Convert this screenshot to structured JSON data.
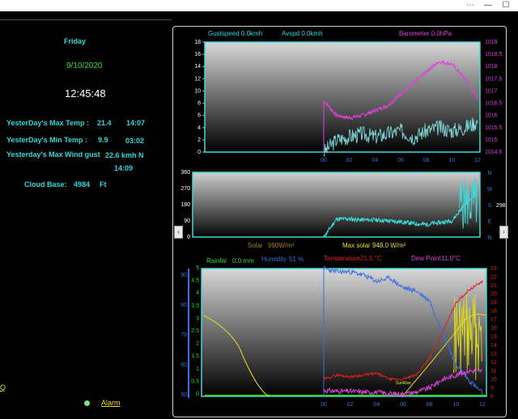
{
  "window": {
    "minimize": "—",
    "maximize": "☐",
    "close": "✕",
    "extra": "⋯"
  },
  "left": {
    "day": "Friday",
    "date": "9/10/2020",
    "time": "12:45:48",
    "max_temp_label": "YesterDay's Max Temp :",
    "max_temp_value": "21.4",
    "max_temp_time": "14:07",
    "min_temp_label": "YesterDay's Min Temp :",
    "min_temp_value": "9.9",
    "min_temp_time": "03:02",
    "max_gust_label": "Yesterday's Max Wind gust",
    "max_gust_value": "22.6 kmh N",
    "max_gust_time": "14:09",
    "cloud_label": "Cloud Base:",
    "cloud_value": "4984",
    "cloud_unit": "Ft",
    "alarm_label": "Alarm",
    "left_link": "Q"
  },
  "chart_data": [
    {
      "type": "line",
      "legend": {
        "gust": "Gustspeed  0.0kmh",
        "avg": "Avspd  0.0kmh",
        "baro": "Barometer     0.0hPa"
      },
      "x_ticks": [
        "00",
        "02",
        "04",
        "06",
        "08",
        "10",
        "12"
      ],
      "y_left_ticks": [
        "18",
        "16",
        "14",
        "12",
        "10",
        "8",
        "6",
        "4",
        "2",
        "0"
      ],
      "y_right_ticks": [
        "1019",
        "1018.5",
        "1018",
        "1017.5",
        "1017",
        "1016.5",
        "1016",
        "1015.5",
        "1015",
        "1014.5"
      ],
      "ylim": [
        0,
        18
      ],
      "ylim_right": [
        1014.5,
        1019
      ],
      "colors": {
        "baro": "#e040e0",
        "wind": "#7fd8d8"
      },
      "series": [
        {
          "name": "Barometer",
          "x": [
            0,
            1,
            2,
            3,
            4,
            5,
            6,
            7,
            8,
            9,
            10,
            11,
            12
          ],
          "values": [
            1016.6,
            1016,
            1015.9,
            1016,
            1016.2,
            1016.4,
            1016.9,
            1017.3,
            1017.8,
            1018.2,
            1018.1,
            1017.5,
            1016.7
          ]
        },
        {
          "name": "Gustspeed",
          "x": [
            0,
            1,
            2,
            3,
            4,
            5,
            6,
            7,
            8,
            9,
            10,
            11,
            12
          ],
          "values": [
            0,
            2,
            2.5,
            3,
            2.5,
            3,
            3.5,
            2.5,
            3.5,
            4,
            3.5,
            4,
            5
          ]
        }
      ]
    },
    {
      "type": "line",
      "y_left_ticks": [
        "360",
        "270",
        "180",
        "90",
        "0"
      ],
      "y_right_ticks": [
        "N",
        "W",
        "S",
        "E",
        "N"
      ],
      "right_value": "298",
      "ylim": [
        0,
        360
      ],
      "colors": {
        "dir": "#40d8d8"
      },
      "series": [
        {
          "name": "Wind Direction",
          "x": [
            0,
            1,
            2,
            3,
            4,
            5,
            6,
            7,
            8,
            9,
            10,
            11,
            12
          ],
          "values": [
            0,
            100,
            100,
            95,
            95,
            90,
            85,
            75,
            70,
            80,
            90,
            180,
            250
          ]
        }
      ]
    },
    {
      "type": "line",
      "solar": {
        "label": "Solar",
        "value": "990W/m²",
        "max_label": "Max solar",
        "max_value": "948.0 W/m²"
      },
      "legend": {
        "rain": "Rainfal",
        "rain_value": "0.0 mm",
        "hum": "Humidity",
        "hum_value": "51 %",
        "temp": "Temperature",
        "temp_value": "21.5 °C",
        "dew": "Dew Point",
        "dew_value": "11.0°C"
      },
      "annotation": "SunRise",
      "x_ticks": [
        "00",
        "02",
        "04",
        "06",
        "08",
        "10",
        "12"
      ],
      "y_rain_ticks": [
        "5",
        "4.5",
        "4",
        "3.5",
        "3",
        "2.5",
        "2",
        "1.5",
        "1",
        "0.5",
        "0"
      ],
      "y_hum_ticks": [
        "90",
        "80",
        "70",
        "60",
        "50"
      ],
      "y_temp_ticks": [
        "23",
        "22",
        "21",
        "20",
        "19",
        "18",
        "17",
        "16",
        "15",
        "14",
        "13",
        "12",
        "11",
        "10",
        "9",
        "8"
      ],
      "ylim_temp": [
        8,
        23
      ],
      "ylim_hum": [
        50,
        90
      ],
      "colors": {
        "temp": "#e02020",
        "hum": "#3a6fe0",
        "dew": "#e040e0",
        "solar": "#e8e020",
        "rain": "#30d830"
      },
      "series": [
        {
          "name": "Temperature",
          "x": [
            0,
            1,
            2,
            3,
            4,
            5,
            6,
            7,
            8,
            9,
            10,
            11,
            12
          ],
          "values": [
            10,
            10.5,
            10.3,
            10.5,
            10.7,
            10,
            10,
            10.5,
            12.5,
            15.5,
            19,
            20.5,
            21.5
          ]
        },
        {
          "name": "Humidity",
          "x": [
            0,
            1,
            2,
            3,
            4,
            5,
            6,
            7,
            8,
            9,
            10,
            11,
            12
          ],
          "values": [
            90,
            89,
            89,
            88,
            86,
            87,
            84,
            83,
            80,
            70,
            60,
            55,
            51
          ]
        },
        {
          "name": "Dew Point",
          "x": [
            0,
            1,
            2,
            3,
            4,
            5,
            6,
            7,
            8,
            9,
            10,
            11,
            12
          ],
          "values": [
            8.7,
            8.6,
            8.6,
            8.5,
            8.5,
            8.3,
            8.3,
            8.5,
            9,
            10,
            10.5,
            11,
            11
          ]
        },
        {
          "name": "Solar",
          "x": [
            0,
            1,
            2,
            3,
            4,
            5,
            6,
            7,
            8,
            9,
            10,
            11,
            12
          ],
          "values": [
            0,
            0,
            0,
            0,
            0,
            0,
            0,
            0,
            0.5,
            1.5,
            3,
            4.5,
            3
          ]
        }
      ]
    }
  ]
}
